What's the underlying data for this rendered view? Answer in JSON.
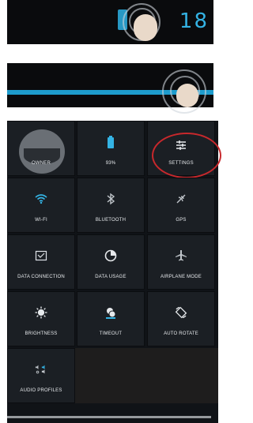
{
  "step1": {
    "time": "18"
  },
  "panel": {
    "tiles": [
      {
        "label": "OWNER"
      },
      {
        "label": "93%"
      },
      {
        "label": "SETTINGS"
      },
      {
        "label": "WI-FI"
      },
      {
        "label": "BLUETOOTH"
      },
      {
        "label": "GPS"
      },
      {
        "label": "DATA CONNECTION"
      },
      {
        "label": "DATA USAGE"
      },
      {
        "label": "AIRPLANE MODE"
      },
      {
        "label": "BRIGHTNESS"
      },
      {
        "label": "TIMEOUT"
      },
      {
        "label": "AUTO ROTATE"
      },
      {
        "label": "AUDIO PROFILES"
      }
    ]
  },
  "colors": {
    "accent": "#34b3e4",
    "highlight": "#c8282c"
  },
  "icons": {
    "battery": "battery-icon",
    "settings": "settings-sliders-icon",
    "wifi": "wifi-icon",
    "bluetooth": "bluetooth-icon",
    "gps": "gps-icon",
    "data_connection": "data-connection-icon",
    "data_usage": "data-usage-icon",
    "airplane": "airplane-icon",
    "brightness": "brightness-icon",
    "timeout": "timeout-icon",
    "auto_rotate": "auto-rotate-icon",
    "audio_profiles": "audio-profiles-icon"
  }
}
